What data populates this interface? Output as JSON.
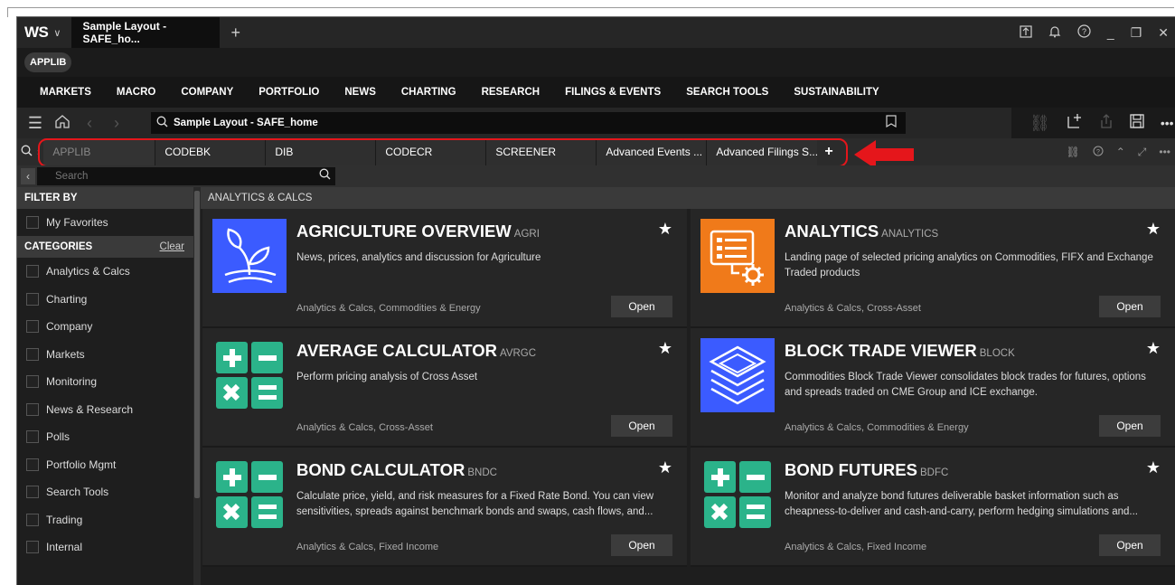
{
  "titlebar": {
    "logo": "WS",
    "window_tab": "Sample Layout - SAFE_ho...",
    "add_tab": "+",
    "controls": [
      "⛶",
      "🔔",
      "?",
      "_",
      "❐",
      "✕"
    ]
  },
  "pill": {
    "label": "APPLIB"
  },
  "menu": {
    "items": [
      "MARKETS",
      "MACRO",
      "COMPANY",
      "PORTFOLIO",
      "NEWS",
      "CHARTING",
      "RESEARCH",
      "FILINGS & EVENTS",
      "SEARCH TOOLS",
      "SUSTAINABILITY"
    ]
  },
  "toolbar": {
    "address": "Sample Layout - SAFE_home"
  },
  "tabs": {
    "items": [
      {
        "label": "APPLIB",
        "active": true
      },
      {
        "label": "CODEBK",
        "active": false
      },
      {
        "label": "DIB",
        "active": false
      },
      {
        "label": "CODECR",
        "active": false
      },
      {
        "label": "SCREENER",
        "active": false
      },
      {
        "label": "Advanced Events ...",
        "active": false
      },
      {
        "label": "Advanced Filings S...",
        "active": false
      }
    ],
    "add": "+"
  },
  "search": {
    "placeholder": "Search"
  },
  "sidebar": {
    "filter_by": "FILTER BY",
    "favorites": "My Favorites",
    "categories_label": "CATEGORIES",
    "clear": "Clear",
    "categories": [
      "Analytics & Calcs",
      "Charting",
      "Company",
      "Markets",
      "Monitoring",
      "News & Research",
      "Polls",
      "Portfolio Mgmt",
      "Search Tools",
      "Trading",
      "Internal"
    ]
  },
  "main": {
    "heading": "ANALYTICS & CALCS",
    "open_label": "Open",
    "cards": [
      {
        "title": "AGRICULTURE OVERVIEW",
        "code": "AGRI",
        "desc": "News, prices, analytics and discussion for Agriculture",
        "cats": "Analytics & Calcs, Commodities & Energy",
        "icon": "plant-icon",
        "color": "#3b5bff"
      },
      {
        "title": "ANALYTICS",
        "code": "ANALYTICS",
        "desc": "Landing page of selected pricing analytics on Commodities, FIFX and Exchange Traded products",
        "cats": "Analytics & Calcs, Cross-Asset",
        "icon": "dashboard-gear-icon",
        "color": "#f07a1a"
      },
      {
        "title": "AVERAGE CALCULATOR",
        "code": "AVRGC",
        "desc": "Perform pricing analysis of Cross Asset",
        "cats": "Analytics & Calcs, Cross-Asset",
        "icon": "calculator-icon",
        "color": "#2bb38a"
      },
      {
        "title": "BLOCK TRADE VIEWER",
        "code": "BLOCK",
        "desc": "Commodities Block Trade Viewer consolidates block trades for futures, options and spreads traded on CME Group and ICE exchange.",
        "cats": "Analytics & Calcs, Commodities & Energy",
        "icon": "layers-icon",
        "color": "#3b5bff"
      },
      {
        "title": "BOND CALCULATOR",
        "code": "BNDC",
        "desc": "Calculate price, yield, and risk measures for a Fixed Rate Bond. You can view sensitivities, spreads against benchmark bonds and swaps, cash flows, and...",
        "cats": "Analytics & Calcs, Fixed Income",
        "icon": "calculator-icon",
        "color": "#2bb38a"
      },
      {
        "title": "BOND FUTURES",
        "code": "BDFC",
        "desc": "Monitor and analyze bond futures deliverable basket information such as cheapness-to-deliver and cash-and-carry, perform hedging simulations and...",
        "cats": "Analytics & Calcs, Fixed Income",
        "icon": "calculator-icon",
        "color": "#2bb38a"
      }
    ]
  },
  "colors": {
    "highlight": "#e5161b",
    "bg": "#1e1e1e"
  }
}
